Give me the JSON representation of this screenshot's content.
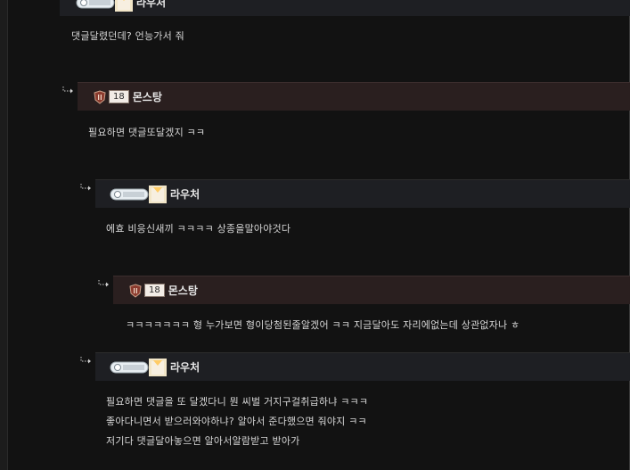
{
  "comments": [
    {
      "username": "라우처",
      "body": [
        "댓글달렸던데? 언능가서 줘"
      ]
    },
    {
      "username": "몬스탕",
      "level": "18",
      "body": [
        "필요하면 댓글또달겠지 ㅋㅋ"
      ]
    },
    {
      "username": "라우처",
      "body": [
        "에효 비응신새끼 ㅋㅋㅋㅋ 상종을말아야것다"
      ]
    },
    {
      "username": "몬스탕",
      "level": "18",
      "body": [
        "ㅋㅋㅋㅋㅋㅋㅋ 형 누가보면 형이당첨된줄알겠어 ㅋㅋ 지금달아도 자리에없는데 상관없자나 ㅎ"
      ]
    },
    {
      "username": "라우처",
      "body": [
        "필요하면 댓글을 또 달겠다니 뭔 씨벌 거지구걸취급하냐 ㅋㅋㅋ",
        "좋아다니면서 받으러와야하냐? 알아서 준다했으면 줘야지 ㅋㅋ",
        "저기다 댓글달아놓으면 알아서알람받고 받아가"
      ]
    }
  ],
  "icons": {
    "reply": "reply-arrow-icon",
    "grade_badge": "grade-badge-icon",
    "shield": "shield-icon",
    "profile": "profile-image-icon"
  },
  "colors": {
    "background": "#121212",
    "header_dark": "#1e1f23",
    "header_brown": "#2a1f1f",
    "text": "#d6d6d6"
  }
}
